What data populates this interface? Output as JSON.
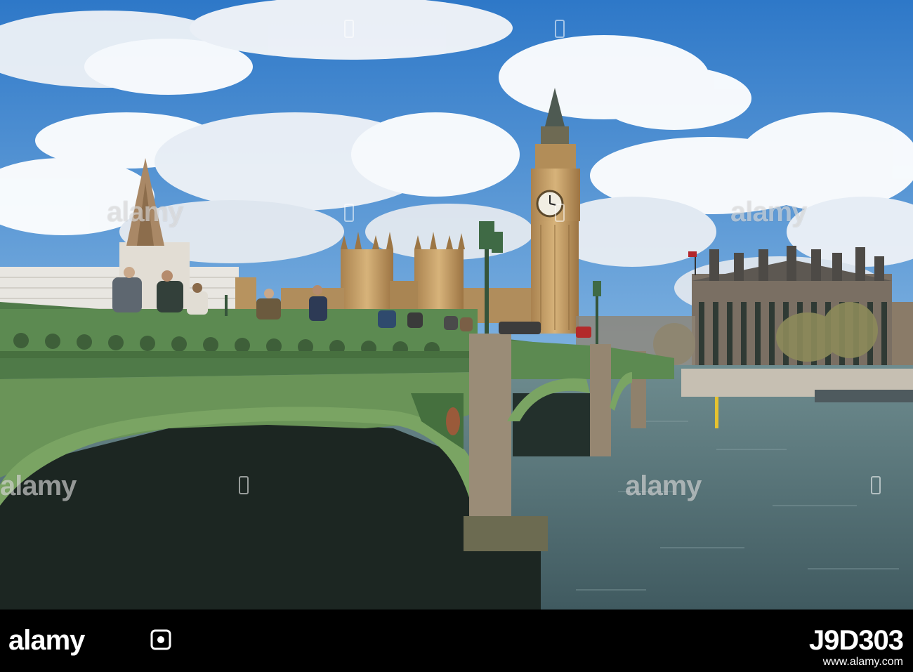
{
  "watermark": {
    "text": "alamy"
  },
  "footer": {
    "logo": "alamy",
    "image_id": "J9D303",
    "site": "www.alamy.com"
  },
  "colors": {
    "sky": "#3f86d0",
    "cloud": "#ffffff",
    "bridge_green": "#5b8a4e",
    "stone": "#b89a73",
    "river": "#5d7a80",
    "footer_bg": "#000000"
  }
}
